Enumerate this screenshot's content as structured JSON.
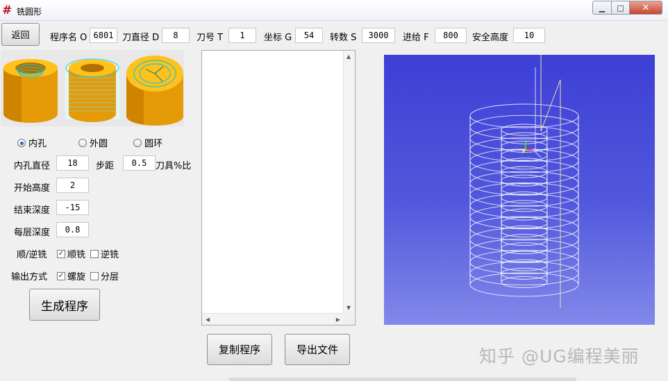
{
  "window": {
    "title": "铣圆形",
    "icon": "#"
  },
  "toolbar": {
    "back_label": "返回",
    "program_name_label": "程序名 O",
    "program_name_value": "6801",
    "tool_diameter_label": "刀直径 D",
    "tool_diameter_value": "8",
    "tool_number_label": "刀号 T",
    "tool_number_value": "1",
    "coordinate_label": "坐标 G",
    "coordinate_value": "54",
    "spindle_label": "转数 S",
    "spindle_value": "3000",
    "feed_label": "进给 F",
    "feed_value": "800",
    "safe_height_label": "安全高度",
    "safe_height_value": "10"
  },
  "mode": {
    "inner_label": "内孔",
    "outer_label": "外圆",
    "ring_label": "圆环",
    "selected": "内孔"
  },
  "params": {
    "hole_diameter_label": "内孔直径",
    "hole_diameter_value": "18",
    "step_label": "步距",
    "step_value": "0.5",
    "tool_percent_label": "刀具%比",
    "start_height_label": "开始高度",
    "start_height_value": "2",
    "end_depth_label": "结束深度",
    "end_depth_value": "-15",
    "layer_depth_label": "每层深度",
    "layer_depth_value": "0.8",
    "direction_label": "顺/逆铣",
    "climb_label": "顺铣",
    "climb_checked": true,
    "conventional_label": "逆铣",
    "conventional_checked": false,
    "output_label": "输出方式",
    "spiral_label": "螺旋",
    "spiral_checked": true,
    "layered_label": "分层",
    "layered_checked": false
  },
  "actions": {
    "generate_label": "生成程序",
    "copy_label": "复制程序",
    "export_label": "导出文件"
  },
  "watermark": "知乎 @UG编程美丽",
  "colors": {
    "viewport_top": "#3d3fd6",
    "viewport_bottom": "#8189ea",
    "part_orange": "#e59b07",
    "part_top": "#ffc21a",
    "toolpath": "#ffffff"
  }
}
